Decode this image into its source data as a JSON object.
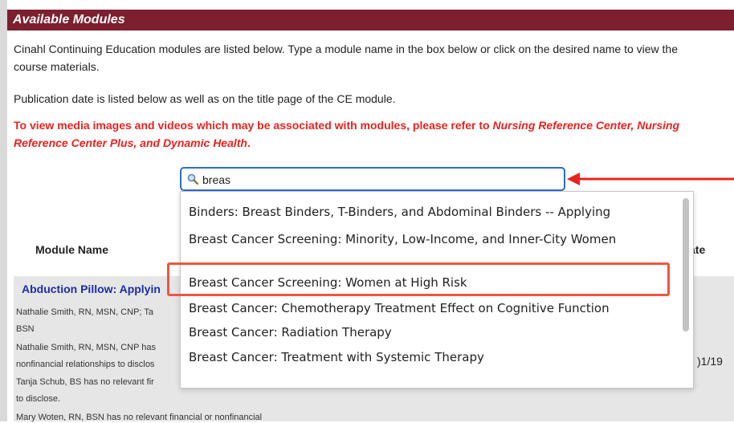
{
  "colors": {
    "header_bg": "#7d1f2e",
    "warning_red": "#e8231f",
    "link_blue": "#1a2ea8",
    "search_border": "#2c6bd6",
    "highlight": "#f05540"
  },
  "header": {
    "title": "Available Modules"
  },
  "intro": {
    "line1": "Cinahl Continuing Education modules are listed below. Type a module name in the box below or click on the desired name to view the course materials.",
    "line2": "Publication date is listed below as well as on the title page of the CE module.",
    "warning_prefix": "To view media images and videos which may be associated with modules, please refer to ",
    "warning_emph": "Nursing Reference Center, Nursing Reference Center Plus, and Dynamic Health",
    "warning_suffix": "."
  },
  "search": {
    "value": "breas",
    "icon": "magnifier-icon"
  },
  "dropdown": {
    "items": [
      "Binders: Breast Binders, T-Binders, and Abdominal Binders -- Applying",
      "Breast Cancer Screening: Minority, Low-Income, and Inner-City Women",
      "Breast Cancer Screening: Women at High Risk",
      "Breast Cancer: Chemotherapy Treatment Effect on Cognitive Function",
      "Breast Cancer: Radiation Therapy",
      "Breast Cancer: Treatment with Systemic Therapy"
    ],
    "highlighted_index": 2
  },
  "table": {
    "col_module": "Module Name",
    "col_date": "ate",
    "row1": {
      "title": "Abduction Pillow: Applyin",
      "line1": "Nathalie Smith, RN, MSN, CNP; Ta",
      "line2": "BSN",
      "line3": "Nathalie Smith, RN, MSN, CNP has",
      "line4": "nonfinancial relationships to disclos",
      "line5": "Tanja Schub, BS has no relevant fir",
      "line6": "to disclose.",
      "line7": "Mary Woten, RN, BSN has no relevant financial or nonfinancial",
      "date": ")1/19"
    }
  }
}
